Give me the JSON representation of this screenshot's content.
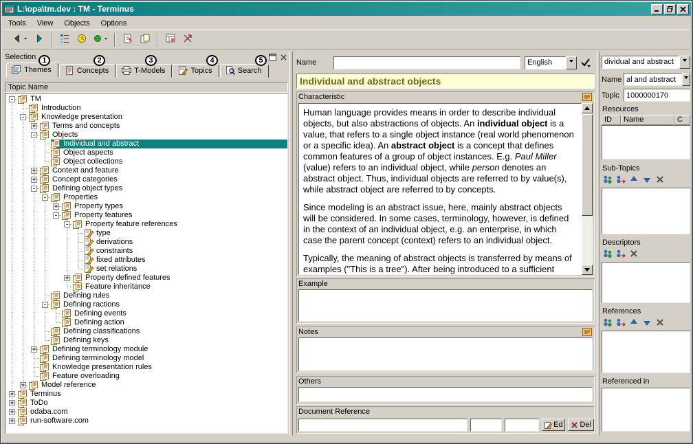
{
  "window": {
    "title": "L:\\opa\\tm.dev : TM - Terminus"
  },
  "menu": {
    "items": [
      "Tools",
      "View",
      "Objects",
      "Options"
    ]
  },
  "toolbar": {
    "buttons": [
      {
        "icon": "back",
        "caret": true,
        "name": "back"
      },
      {
        "icon": "forward",
        "name": "forward"
      },
      {
        "sep": true
      },
      {
        "icon": "outline",
        "name": "outline-view"
      },
      {
        "icon": "clock",
        "name": "history"
      },
      {
        "icon": "status",
        "caret": true,
        "name": "status"
      },
      {
        "sep": true
      },
      {
        "icon": "paste",
        "name": "check-out"
      },
      {
        "icon": "pages",
        "name": "copy-topic"
      },
      {
        "sep": true
      },
      {
        "icon": "form",
        "name": "delete-form"
      },
      {
        "icon": "crossarrows",
        "name": "cross-reference"
      }
    ]
  },
  "annotations": {
    "badges": [
      "1",
      "2",
      "3",
      "4",
      "5"
    ]
  },
  "selection_panel": {
    "title": "Selection",
    "tabs": [
      {
        "label": "Themes",
        "icon": "themes"
      },
      {
        "label": "Concepts",
        "icon": "concepts"
      },
      {
        "label": "T-Models",
        "icon": "tmodels"
      },
      {
        "label": "Topics",
        "icon": "topics"
      },
      {
        "label": "Search",
        "icon": "search"
      }
    ],
    "tree_header": "Topic Name",
    "tree": [
      {
        "label": "TM",
        "depth": 0,
        "toggle": "-"
      },
      {
        "label": "Introduction",
        "depth": 1
      },
      {
        "label": "Knowledge presentation",
        "depth": 1,
        "toggle": "-"
      },
      {
        "label": "Terms and concepts",
        "depth": 2,
        "toggle": "+"
      },
      {
        "label": "Objects",
        "depth": 2,
        "toggle": "-"
      },
      {
        "label": "Individual and abstract",
        "depth": 3,
        "selected": true
      },
      {
        "label": "Object aspects",
        "depth": 3
      },
      {
        "label": "Object collections",
        "depth": 3
      },
      {
        "label": "Context and feature",
        "depth": 2,
        "toggle": "+"
      },
      {
        "label": "Concept categories",
        "depth": 2,
        "toggle": "+"
      },
      {
        "label": "Defining object types",
        "depth": 2,
        "toggle": "-"
      },
      {
        "label": "Properties",
        "depth": 3,
        "toggle": "-"
      },
      {
        "label": "Property types",
        "depth": 4,
        "toggle": "+"
      },
      {
        "label": "Property features",
        "depth": 4,
        "toggle": "-"
      },
      {
        "label": "Property feature references",
        "depth": 5,
        "toggle": "-"
      },
      {
        "label": "type",
        "depth": 6,
        "icon": "edit"
      },
      {
        "label": "derivations",
        "depth": 6,
        "icon": "edit"
      },
      {
        "label": "constraints",
        "depth": 6,
        "icon": "edit"
      },
      {
        "label": "fixed attributes",
        "depth": 6,
        "icon": "edit"
      },
      {
        "label": "set relations",
        "depth": 6,
        "icon": "edit"
      },
      {
        "label": "Property defined features",
        "depth": 5,
        "toggle": "+"
      },
      {
        "label": "Feature inheritance",
        "depth": 5
      },
      {
        "label": "Defining rules",
        "depth": 3
      },
      {
        "label": "Defining ractions",
        "depth": 3,
        "toggle": "-"
      },
      {
        "label": "Defining events",
        "depth": 4
      },
      {
        "label": "Defining action",
        "depth": 4
      },
      {
        "label": "Defining classifications",
        "depth": 3
      },
      {
        "label": "Defining keys",
        "depth": 3
      },
      {
        "label": "Defining terminology module",
        "depth": 2,
        "toggle": "+"
      },
      {
        "label": "Defining terminology model",
        "depth": 2
      },
      {
        "label": "Knowledge presentation rules",
        "depth": 2
      },
      {
        "label": "Feature overloading",
        "depth": 2
      },
      {
        "label": "Model reference",
        "depth": 1,
        "toggle": "+"
      },
      {
        "label": "Terminus",
        "depth": 0,
        "toggle": "+"
      },
      {
        "label": "ToDo",
        "depth": 0,
        "toggle": "+"
      },
      {
        "label": "odaba.com",
        "depth": 0,
        "toggle": "+"
      },
      {
        "label": "run-software.com",
        "depth": 0,
        "toggle": "+"
      }
    ]
  },
  "editor": {
    "name_label": "Name",
    "name_value": "",
    "language_value": "English",
    "title": "Individual and abstract objects",
    "characteristic_label": "Characteristic",
    "characteristic_paragraphs": [
      [
        {
          "t": "Human language provides means in order to describe individual objects, but also abstractions of objects. An "
        },
        {
          "t": "individual object",
          "b": true
        },
        {
          "t": " is a value, that refers to a single object instance (real world phenomenon or a specific idea). An "
        },
        {
          "t": "abstract object",
          "b": true
        },
        {
          "t": " is a concept that defines common features of a group of object instances. E.g. "
        },
        {
          "t": "Paul Miller",
          "i": true
        },
        {
          "t": " (value) refers to an individual object, while "
        },
        {
          "t": "person",
          "i": true
        },
        {
          "t": " denotes an abstract object. Thus, individual objects are referred to by value(s), while abstract object are referred to by concepts."
        }
      ],
      [
        {
          "t": "Since modeling is an abstract issue, here, mainly abstract objects will be considered. In some cases, terminology, however, is defined in the context of an individual object, e.g. an enterprise, in which case the parent concept (context) refers to an individual object."
        }
      ],
      [
        {
          "t": "Typically, the meaning of abstract objects is transferred by means of examples (\"This is a tree\"). After being introduced to a sufficient number of tree examples, children abstract the term tree with their typical features."
        }
      ]
    ],
    "example_label": "Example",
    "example_value": "",
    "notes_label": "Notes",
    "notes_value": "",
    "others_label": "Others",
    "others_value": "",
    "document_reference_label": "Document Reference",
    "document_reference_value": "",
    "edit_button": "Ed",
    "delete_button": "Del"
  },
  "right_panel": {
    "selector_value": "dividual and abstract",
    "name_label": "Name",
    "name_value": "al and abstract",
    "topic_label": "Topic",
    "topic_value": "1000000170",
    "resources": {
      "label": "Resources",
      "columns": [
        "ID",
        "Name",
        "C"
      ]
    },
    "subtopics": {
      "label": "Sub-Topics",
      "tools": [
        "insert",
        "assign",
        "up",
        "down",
        "delete"
      ]
    },
    "descriptors": {
      "label": "Descriptors",
      "tools": [
        "insert",
        "assign",
        "delete"
      ]
    },
    "references": {
      "label": "References",
      "tools": [
        "insert",
        "assign",
        "up",
        "down",
        "delete"
      ]
    },
    "referenced_in": {
      "label": "Referenced in"
    }
  }
}
